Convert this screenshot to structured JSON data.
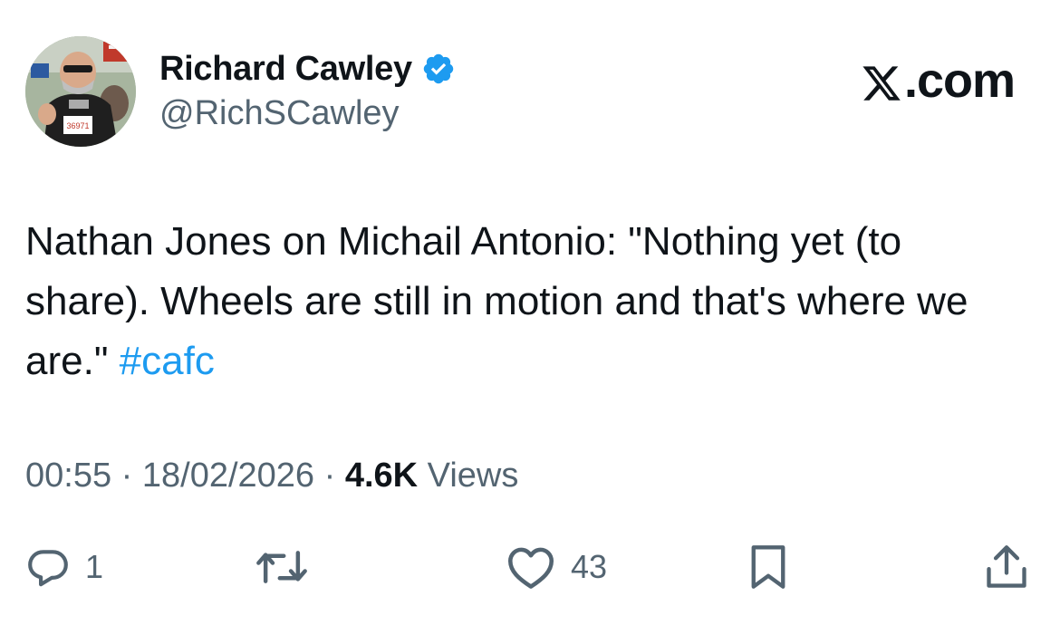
{
  "author": {
    "display_name": "Richard Cawley",
    "handle": "@RichSCawley",
    "verified_icon": "verified-badge-icon",
    "avatar_bib": "36971"
  },
  "brand": {
    "logo_icon": "x-logo-icon",
    "label": ".com"
  },
  "tweet": {
    "text": "Nathan Jones on Michail Antonio: \"Nothing yet (to share). Wheels are still in motion and that's where we are.\" ",
    "hashtag": "#cafc"
  },
  "meta": {
    "time": "00:55",
    "sep1": " · ",
    "date": "18/02/2026",
    "sep2": " · ",
    "views_count": "4.6K",
    "views_label": " Views"
  },
  "actions": {
    "reply_count": "1",
    "like_count": "43"
  },
  "colors": {
    "text": "#0f1419",
    "secondary": "#536471",
    "accent": "#1d9bf0"
  }
}
